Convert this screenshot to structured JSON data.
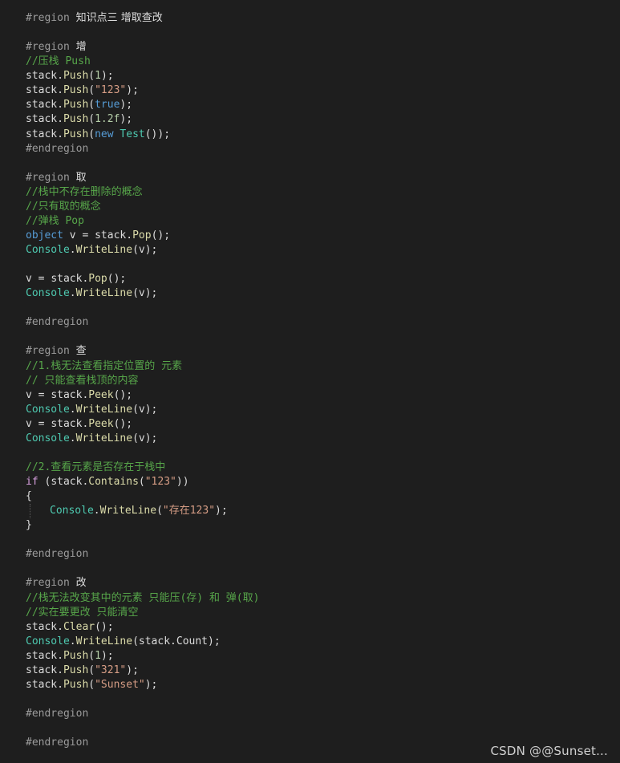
{
  "code": {
    "directive_region": "#region",
    "directive_endregion": "#endregion",
    "region_main": "知识点三 增取查改",
    "region_add": "增",
    "region_take": "取",
    "region_find": "查",
    "region_change": "改",
    "comment_push": "//压栈 Push",
    "comment_no_delete": "//栈中不存在删除的概念",
    "comment_only_take": "//只有取的概念",
    "comment_pop": "//弹栈 Pop",
    "comment_peek_1": "//1.栈无法查看指定位置的 元素",
    "comment_peek_2": "// 只能查看栈顶的内容",
    "comment_contains": "//2.查看元素是否存在于栈中",
    "comment_change_1": "//栈无法改变其中的元素 只能压(存) 和 弹(取)",
    "comment_change_2": "//实在要更改 只能清空",
    "tok_stack": "stack",
    "tok_dot": ".",
    "tok_push": "Push",
    "tok_pop": "Pop",
    "tok_peek": "Peek",
    "tok_contains": "Contains",
    "tok_clear": "Clear",
    "tok_count": "Count",
    "tok_console": "Console",
    "tok_writeline": "WriteLine",
    "tok_object": "object",
    "tok_new": "new",
    "tok_true": "true",
    "tok_if": "if",
    "tok_test": "Test",
    "tok_v": "v",
    "tok_assign": " = ",
    "tok_lparen": "(",
    "tok_rparen_semi": ");",
    "tok_call_semi": "();",
    "tok_new_end": "());",
    "tok_if_open": " (",
    "tok_if_close": "))",
    "tok_lbrace": "{",
    "tok_rbrace": "}",
    "num_1": "1",
    "num_1_2f": "1.2f",
    "str_123": "\"123\"",
    "str_exist": "\"存在123\"",
    "str_321": "\"321\"",
    "str_sunset": "\"Sunset\""
  },
  "watermark": "CSDN @@Sunset..."
}
